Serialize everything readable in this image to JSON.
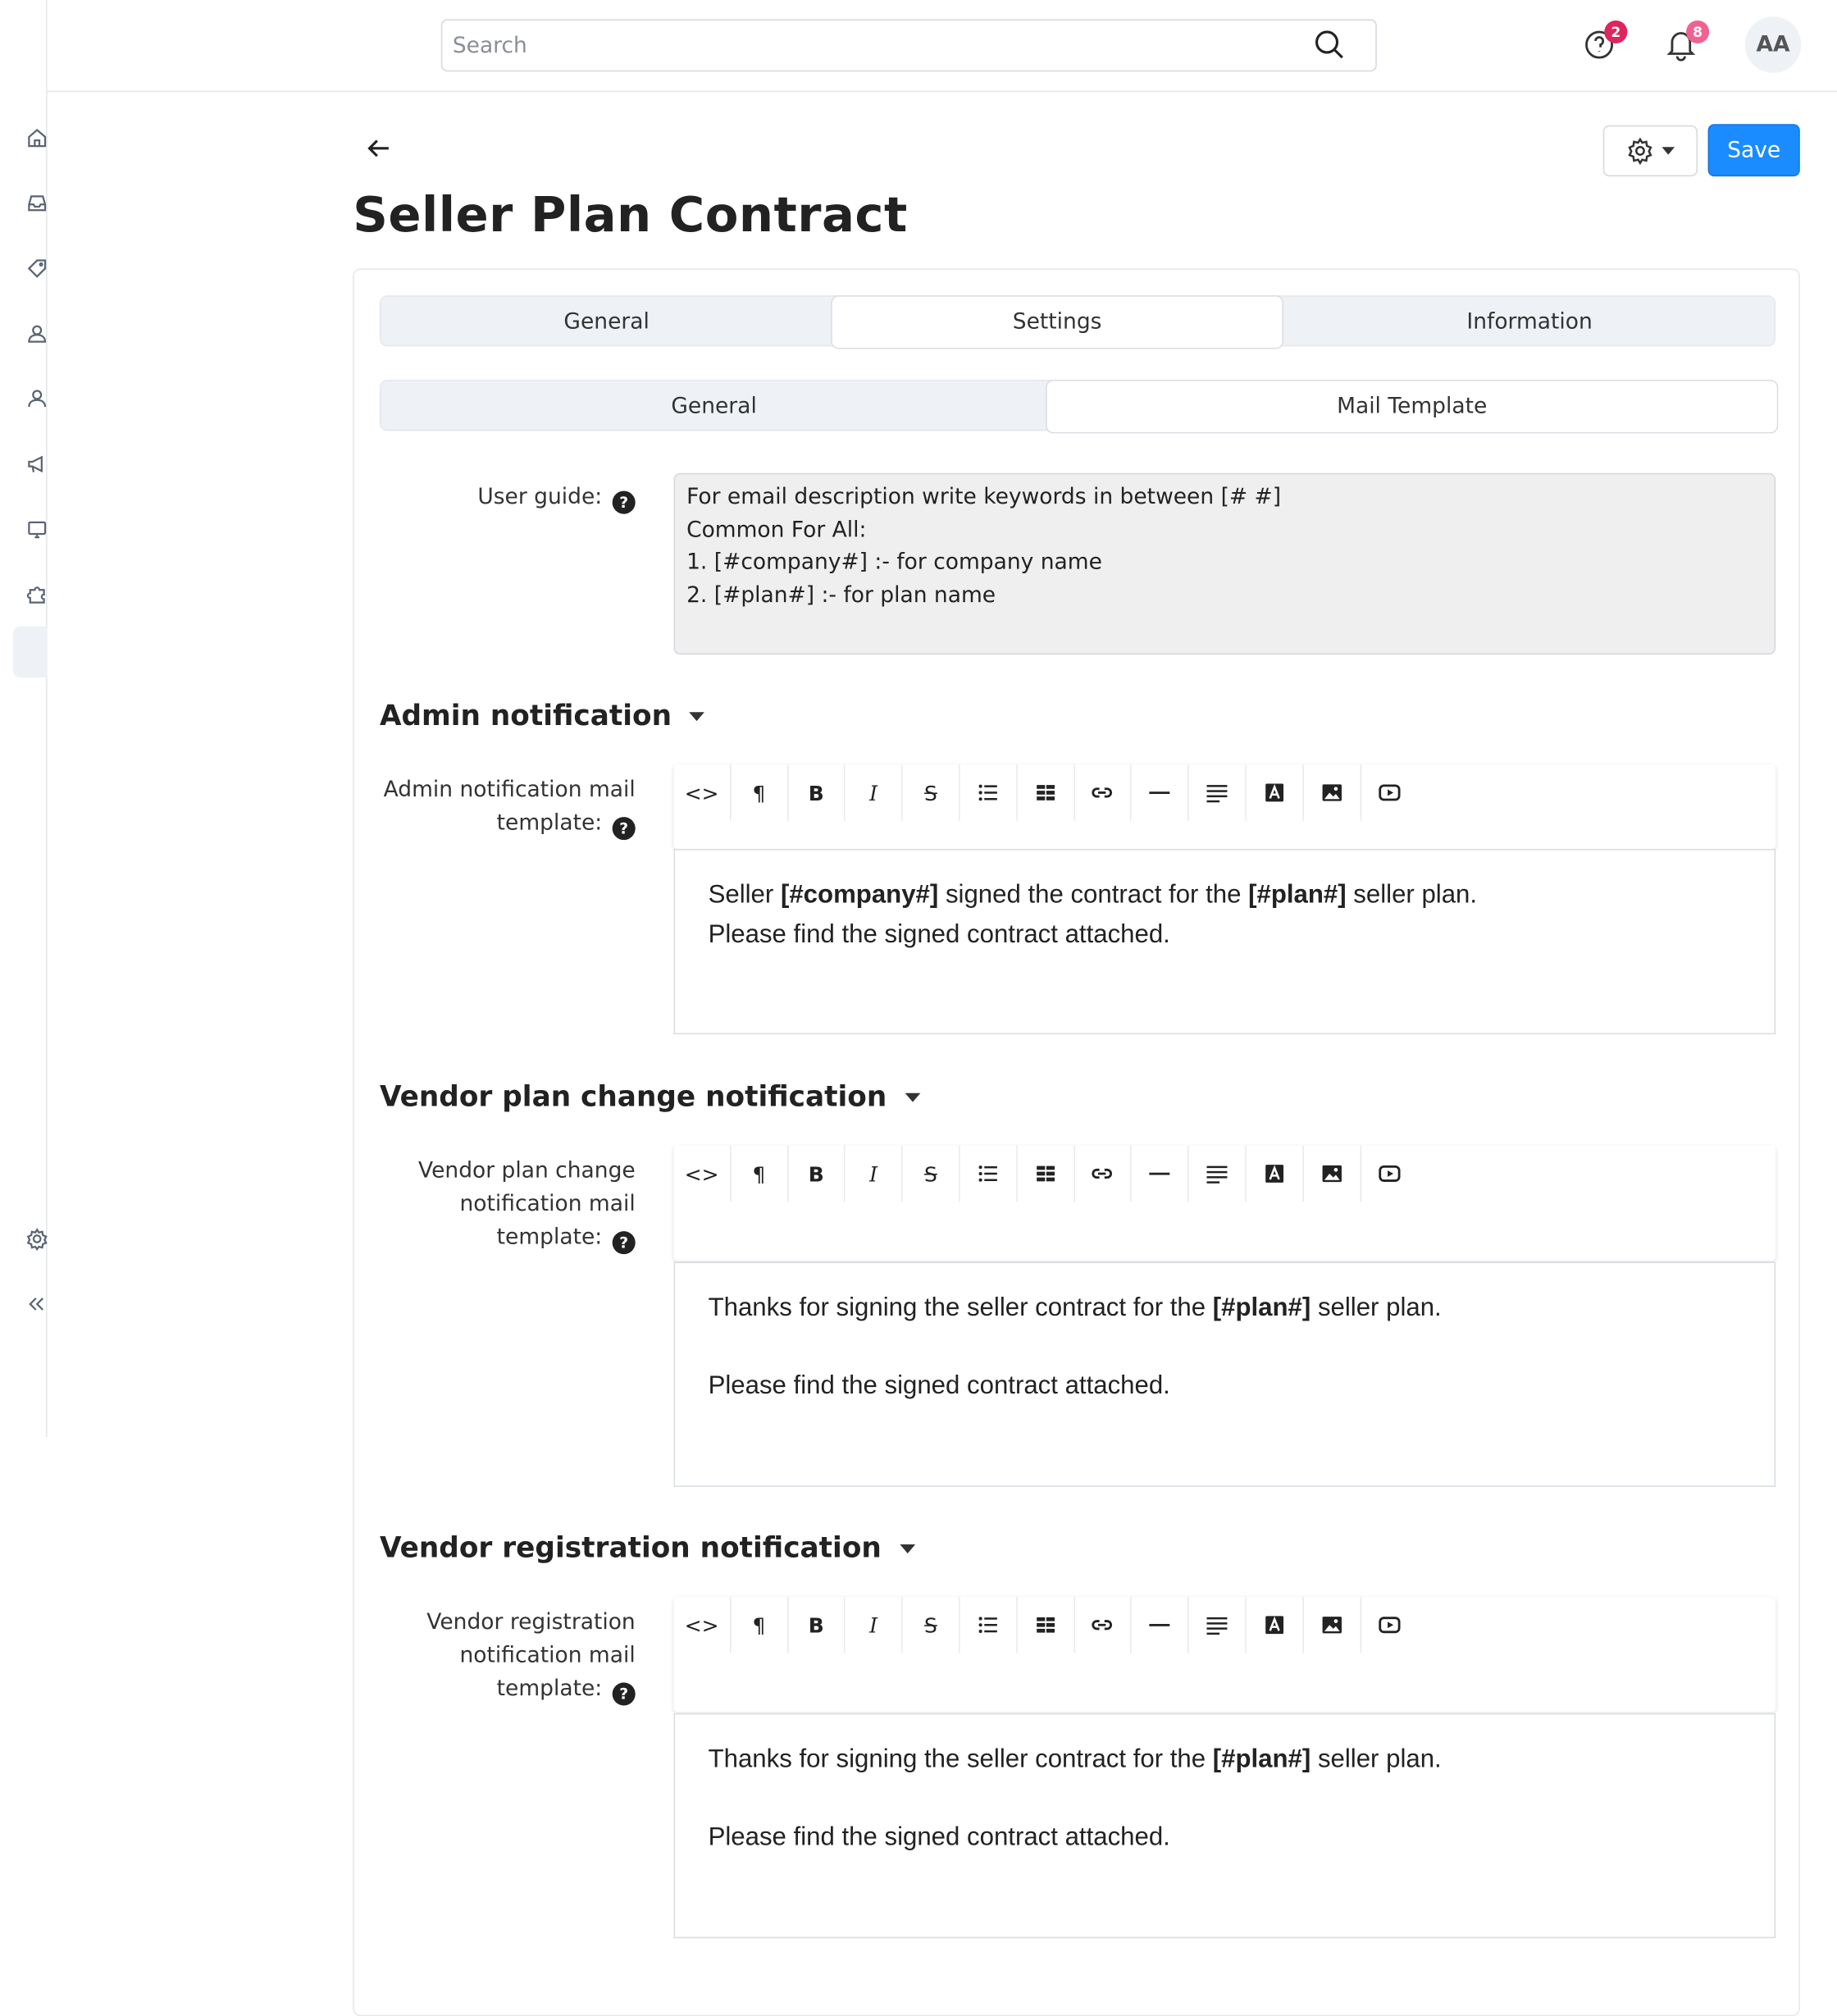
{
  "search": {
    "placeholder": "Search"
  },
  "header": {
    "help_badge": "2",
    "notifications_badge": "8",
    "avatar_initials": "AA"
  },
  "page": {
    "title": "Seller Plan Contract",
    "save_label": "Save"
  },
  "tabs": [
    {
      "label": "General",
      "active": false
    },
    {
      "label": "Settings",
      "active": true
    },
    {
      "label": "Information",
      "active": false
    }
  ],
  "subtabs": [
    {
      "label": "General",
      "active": false
    },
    {
      "label": "Mail Template",
      "active": true
    }
  ],
  "user_guide": {
    "label": "User guide:",
    "lines": [
      "For email description write keywords in between [# #]",
      "Common For All:",
      "1. [#company#] :- for company name",
      "2. [#plan#] :- for plan name"
    ]
  },
  "sections": {
    "admin": {
      "title": "Admin notification",
      "label_line1": "Admin notification mail",
      "label_line2": "template:",
      "p1_a": "Seller ",
      "p1_b": "[#company#]",
      "p1_c": " signed the contract for the ",
      "p1_d": "[#plan#]",
      "p1_e": " seller plan.",
      "p2": "Please find the signed contract attached."
    },
    "vendor_plan": {
      "title": "Vendor plan change notification",
      "label_line1": "Vendor plan change",
      "label_line2": "notification mail",
      "label_line3": "template:",
      "p1_a": "Thanks for signing the seller contract for the ",
      "p1_b": "[#plan#]",
      "p1_c": " seller plan.",
      "p2": "Please find the signed contract attached."
    },
    "vendor_reg": {
      "title": "Vendor registration notification",
      "label_line1": "Vendor registration",
      "label_line2": "notification mail",
      "label_line3": "template:",
      "p1_a": "Thanks for signing the seller contract for the ",
      "p1_b": "[#plan#]",
      "p1_c": " seller plan.",
      "p2": "Please find the signed contract attached."
    }
  },
  "toolbar": {
    "code": "<>",
    "paragraph": "¶",
    "bold": "B",
    "italic": "I",
    "strike": "S"
  },
  "icons": {
    "sidebar": [
      "home-icon",
      "inbox-icon",
      "tag-icon",
      "customer-icon",
      "user-icon",
      "marketing-icon",
      "monitor-icon",
      "puzzle-icon",
      "settings-icon",
      "collapse-icon"
    ],
    "toolbar": [
      "code-view-icon",
      "paragraph-icon",
      "bold-icon",
      "italic-icon",
      "strikethrough-icon",
      "list-icon",
      "table-icon",
      "link-icon",
      "horizontal-rule-icon",
      "align-icon",
      "font-color-icon",
      "image-icon",
      "video-icon"
    ]
  },
  "colors": {
    "primary": "#1a8cff",
    "badge": "#e0245e",
    "badge_pink": "#f06292"
  }
}
